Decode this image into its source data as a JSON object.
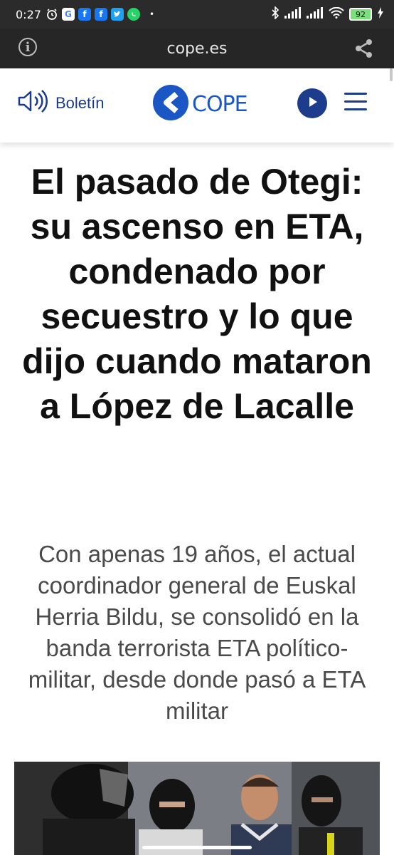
{
  "status_bar": {
    "time": "0:27",
    "battery": "92",
    "notification_icons": [
      "alarm-icon",
      "google-icon",
      "facebook-icon",
      "facebook-icon",
      "twitter-icon",
      "whatsapp-icon"
    ]
  },
  "browser": {
    "url": "cope.es"
  },
  "header": {
    "boletin_label": "Boletín",
    "logo_text": "COPE",
    "brand_color": "#1a56c4",
    "accent_color": "#1d3c8c"
  },
  "article": {
    "title": "El pasado de Otegi: su ascenso en ETA, condenado por secuestro y lo que dijo cuando mataron a López de Lacalle",
    "subtitle": "Con apenas 19 años, el actual coordinador general de Euskal Herria Bildu, se consolidó en la banda terrorista ETA político-militar, desde donde pasó a ETA militar"
  }
}
